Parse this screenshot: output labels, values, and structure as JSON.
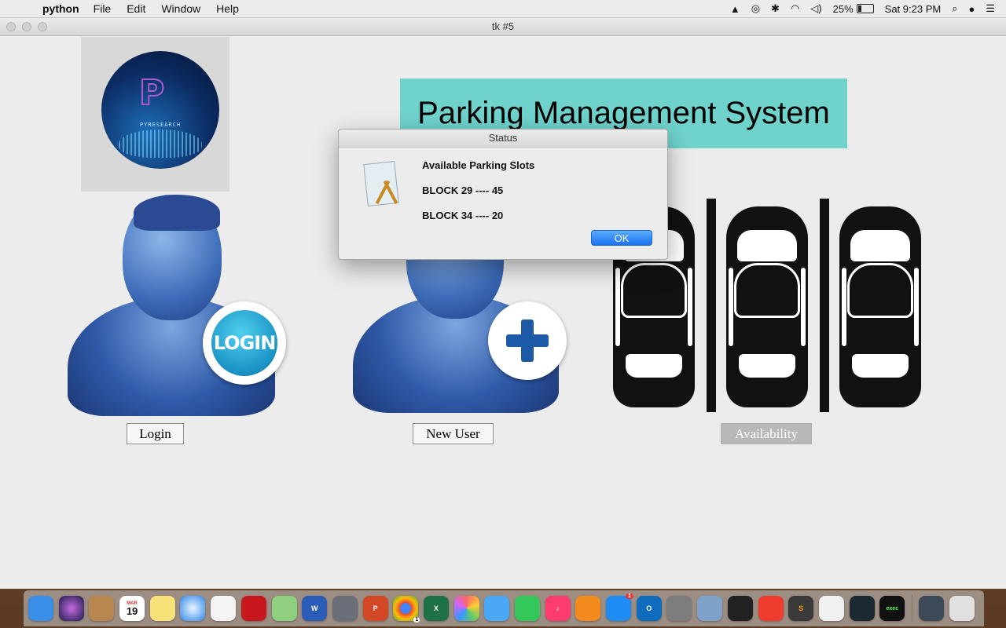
{
  "menubar": {
    "app_name": "python",
    "items": [
      "File",
      "Edit",
      "Window",
      "Help"
    ],
    "battery": "25%",
    "clock": "Sat 9:23 PM"
  },
  "window": {
    "title": "tk #5"
  },
  "logo": {
    "text": "PYRESEARCH"
  },
  "banner": {
    "title": "Parking Management System"
  },
  "buttons": {
    "login": "Login",
    "new_user": "New User",
    "availability": "Availability"
  },
  "badge": {
    "login": "LOGIN"
  },
  "dialog": {
    "title": "Status",
    "heading": "Available Parking Slots",
    "line1": "BLOCK 29 ---- 45",
    "line2": "BLOCK 34 ----  20",
    "ok": "OK"
  },
  "dock": {
    "calendar_month": "MAR",
    "calendar_day": "19",
    "chrome_badge": "1",
    "appstore_badge": "1",
    "exec_label": "exec"
  },
  "colors": {
    "banner_bg": "#6fd3cc",
    "ok_button": "#1a72f0"
  }
}
